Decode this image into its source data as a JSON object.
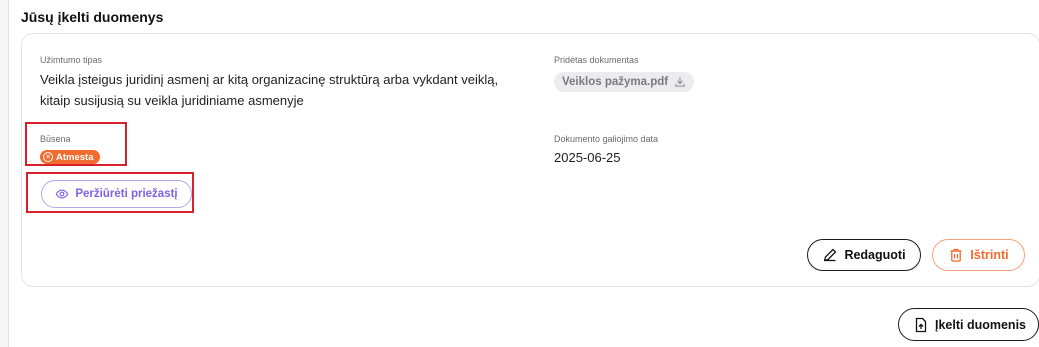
{
  "section": {
    "title": "Jūsų įkelti duomenys"
  },
  "card": {
    "employment_type_label": "Užimtumo tipas",
    "employment_type_value_line1": "Veikla įsteigus juridinį asmenį ar kitą organizacinę struktūrą arba vykdant veiklą,",
    "employment_type_value_line2": "kitaip susijusią su veikla juridiniame asmenyje",
    "attached_doc_label": "Pridėtas dokumentas",
    "attached_doc_name": "Veiklos pažyma.pdf",
    "status_label": "Būsena",
    "status_value": "Atmesta",
    "status_color": "#f26a2e",
    "doc_validity_label": "Dokumento galiojimo data",
    "doc_validity_value": "2025-06-25",
    "view_reason_button": "Peržiūrėti priežastį",
    "edit_button": "Redaguoti",
    "delete_button": "Ištrinti"
  },
  "footer": {
    "upload_button": "Įkelti duomenis"
  },
  "colors": {
    "accent_purple": "#7d61e6",
    "danger_orange": "#f26a2e",
    "highlight_red": "#d8212a"
  }
}
